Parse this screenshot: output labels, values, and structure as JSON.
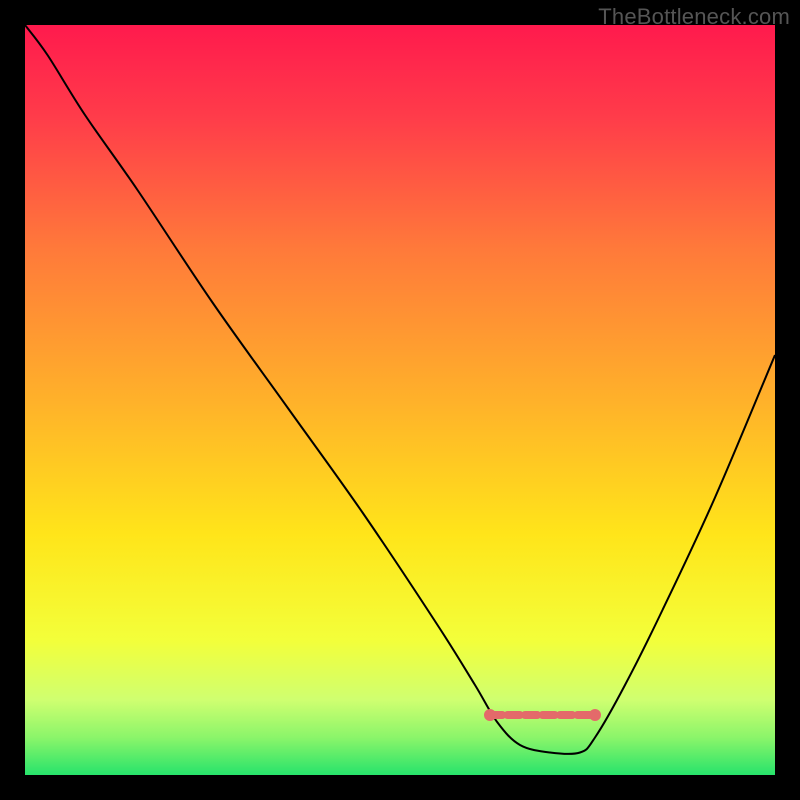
{
  "watermark": "TheBottleneck.com",
  "colors": {
    "gradient_top": "#ff1a4d",
    "gradient_mid": "#ffe51a",
    "gradient_bottom": "#27e36b",
    "curve": "#000000",
    "marker": "#e46a6a",
    "frame": "#000000"
  },
  "chart_data": {
    "type": "line",
    "title": "",
    "xlabel": "",
    "ylabel": "",
    "xlim": [
      0,
      100
    ],
    "ylim": [
      0,
      100
    ],
    "notes": "y is bottleneck penalty (100=worst red, 0=best green). Valley floor is optimal range.",
    "series": [
      {
        "name": "bottleneck-curve",
        "x": [
          0,
          3,
          8,
          15,
          25,
          35,
          45,
          55,
          60,
          63,
          66,
          70,
          74,
          76,
          80,
          85,
          92,
          100
        ],
        "y": [
          100,
          96,
          88,
          78,
          63,
          49,
          35,
          20,
          12,
          7,
          4,
          3,
          3,
          5,
          12,
          22,
          37,
          56
        ]
      }
    ],
    "optimal_range": {
      "x_start": 62,
      "x_end": 76,
      "y": 8
    }
  }
}
